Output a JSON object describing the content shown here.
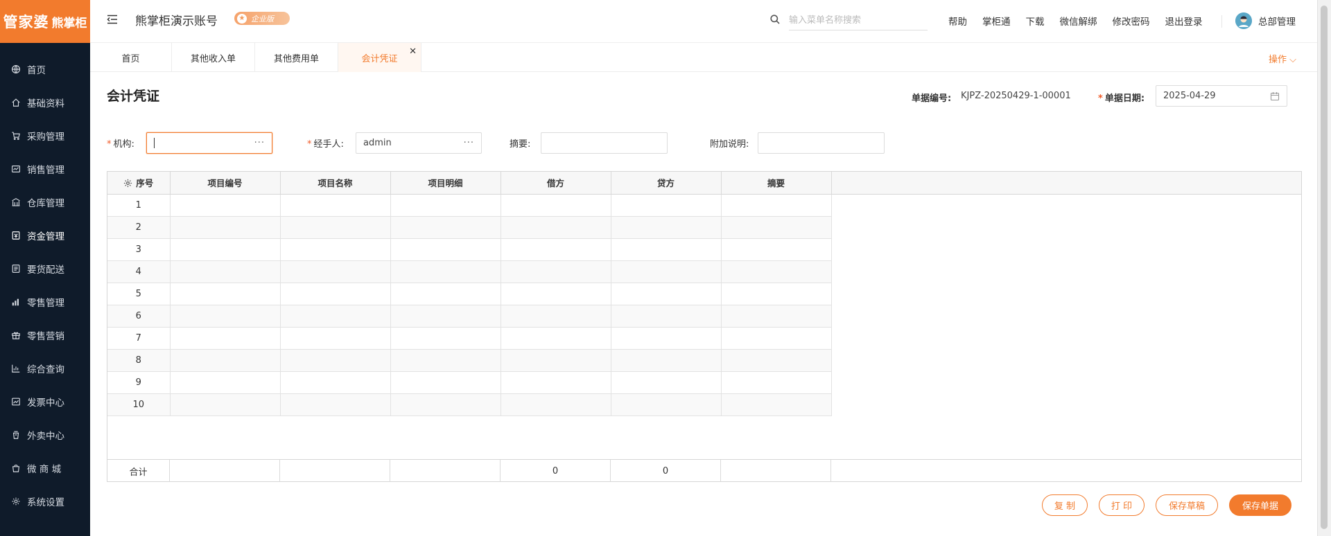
{
  "logo": {
    "brand": "管家婆",
    "product": "熊掌柜"
  },
  "sidebar": {
    "items": [
      {
        "label": "首页",
        "icon": "globe-icon"
      },
      {
        "label": "基础资料",
        "icon": "home-icon"
      },
      {
        "label": "采购管理",
        "icon": "cart-icon"
      },
      {
        "label": "销售管理",
        "icon": "sales-icon"
      },
      {
        "label": "仓库管理",
        "icon": "warehouse-icon"
      },
      {
        "label": "资金管理",
        "icon": "finance-icon"
      },
      {
        "label": "要货配送",
        "icon": "delivery-icon"
      },
      {
        "label": "零售管理",
        "icon": "retail-icon"
      },
      {
        "label": "零售营销",
        "icon": "gift-icon"
      },
      {
        "label": "综合查询",
        "icon": "bar-chart-icon"
      },
      {
        "label": "发票中心",
        "icon": "invoice-icon"
      },
      {
        "label": "外卖中心",
        "icon": "takeout-icon"
      },
      {
        "label": "微 商 城",
        "icon": "shop-icon"
      },
      {
        "label": "系统设置",
        "icon": "settings-icon"
      }
    ],
    "active_index": 5
  },
  "header": {
    "account_name": "熊掌柜演示账号",
    "edition_badge": "企业版",
    "search_placeholder": "输入菜单名称搜索",
    "links": [
      "帮助",
      "掌柜通",
      "下载",
      "微信解绑",
      "修改密码",
      "退出登录"
    ],
    "user_name": "总部管理"
  },
  "tabs": {
    "items": [
      "首页",
      "其他收入单",
      "其他费用单",
      "会计凭证"
    ],
    "active_index": 3,
    "operations": "操作"
  },
  "form": {
    "title": "会计凭证",
    "doc_no_label": "单据编号:",
    "doc_no": "KJPZ-20250429-1-00001",
    "doc_date_label": "单据日期:",
    "doc_date": "2025-04-29",
    "org_label": "机构:",
    "org_value": "",
    "handler_label": "经手人:",
    "handler_value": "admin",
    "summary_label": "摘要:",
    "summary_value": "",
    "note_label": "附加说明:",
    "note_value": ""
  },
  "grid": {
    "columns": [
      "序号",
      "项目编号",
      "项目名称",
      "项目明细",
      "借方",
      "贷方",
      "摘要"
    ],
    "rows": [
      "1",
      "2",
      "3",
      "4",
      "5",
      "6",
      "7",
      "8",
      "9",
      "10"
    ],
    "total_label": "合计",
    "total_debit": "0",
    "total_credit": "0"
  },
  "buttons": {
    "copy": "复 制",
    "print": "打 印",
    "save_draft": "保存草稿",
    "save": "保存单据"
  },
  "colors": {
    "accent": "#f27b2d",
    "sidebar_bg": "#0f1b2a",
    "required": "#f05a28"
  }
}
